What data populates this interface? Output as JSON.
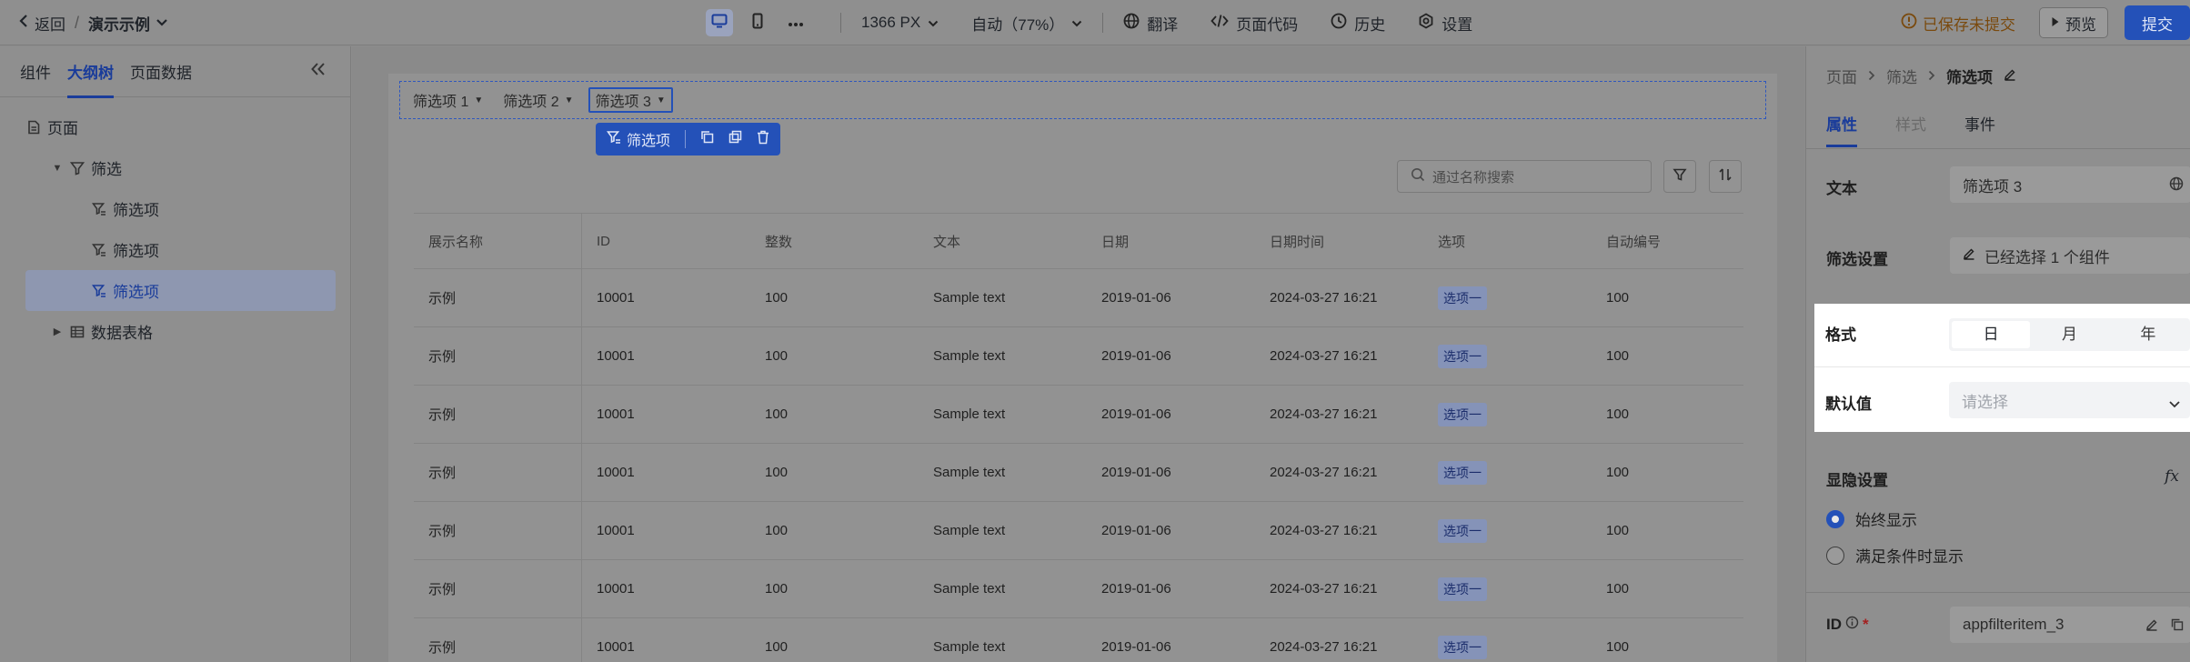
{
  "topbar": {
    "back_label": "返回",
    "app_name": "演示示例",
    "width_value": "1366 PX",
    "zoom_value": "自动（77%）",
    "translate_label": "翻译",
    "page_code_label": "页面代码",
    "history_label": "历史",
    "settings_label": "设置",
    "unsaved_label": "已保存未提交",
    "preview_label": "预览",
    "submit_label": "提交"
  },
  "left_panel": {
    "tabs": [
      "组件",
      "大纲树",
      "页面数据"
    ],
    "active_tab": "大纲树",
    "tree": {
      "page": "页面",
      "filter": "筛选",
      "filter_items": [
        "筛选项",
        "筛选项",
        "筛选项"
      ],
      "table": "数据表格"
    }
  },
  "canvas": {
    "filter_items": [
      "筛选项 1",
      "筛选项 2",
      "筛选项 3"
    ],
    "selection_toolbar_label": "筛选项",
    "search_placeholder": "通过名称搜索",
    "table": {
      "columns": [
        "展示名称",
        "ID",
        "整数",
        "文本",
        "日期",
        "日期时间",
        "选项",
        "自动编号"
      ],
      "rows": [
        [
          "示例",
          "10001",
          "100",
          "Sample text",
          "2019-01-06",
          "2024-03-27 16:21",
          "选项一",
          "100"
        ],
        [
          "示例",
          "10001",
          "100",
          "Sample text",
          "2019-01-06",
          "2024-03-27 16:21",
          "选项一",
          "100"
        ],
        [
          "示例",
          "10001",
          "100",
          "Sample text",
          "2019-01-06",
          "2024-03-27 16:21",
          "选项一",
          "100"
        ],
        [
          "示例",
          "10001",
          "100",
          "Sample text",
          "2019-01-06",
          "2024-03-27 16:21",
          "选项一",
          "100"
        ],
        [
          "示例",
          "10001",
          "100",
          "Sample text",
          "2019-01-06",
          "2024-03-27 16:21",
          "选项一",
          "100"
        ],
        [
          "示例",
          "10001",
          "100",
          "Sample text",
          "2019-01-06",
          "2024-03-27 16:21",
          "选项一",
          "100"
        ],
        [
          "示例",
          "10001",
          "100",
          "Sample text",
          "2019-01-06",
          "2024-03-27 16:21",
          "选项一",
          "100"
        ]
      ]
    }
  },
  "right_panel": {
    "breadcrumb": [
      "页面",
      "筛选",
      "筛选项"
    ],
    "tabs": [
      "属性",
      "样式",
      "事件"
    ],
    "text_label": "文本",
    "text_value": "筛选项 3",
    "filter_settings_label": "筛选设置",
    "filter_settings_value": "已经选择 1 个组件",
    "format_label": "格式",
    "format_options": [
      "日",
      "月",
      "年"
    ],
    "format_selected": "日",
    "default_label": "默认值",
    "default_placeholder": "请选择",
    "visibility_label": "显隐设置",
    "fx_label": "fx",
    "visibility_options": [
      "始终显示",
      "满足条件时显示"
    ],
    "id_label": "ID",
    "id_required": "*",
    "id_value": "appfilteritem_3"
  }
}
